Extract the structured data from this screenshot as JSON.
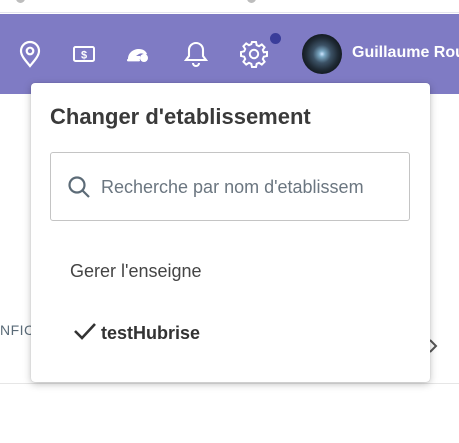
{
  "header": {
    "icons": [
      {
        "name": "location-pin-icon"
      },
      {
        "name": "cash-icon"
      },
      {
        "name": "delivery-icon"
      },
      {
        "name": "bell-icon"
      },
      {
        "name": "gear-icon"
      }
    ],
    "user_name": "Guillaume Rou",
    "colors": {
      "bar": "#7f7bc4",
      "notification": "#3a3d9a"
    }
  },
  "background": {
    "left_text": "NFIC"
  },
  "dropdown": {
    "title": "Changer d'etablissement",
    "search": {
      "placeholder": "Recherche par nom d'etablissem",
      "value": ""
    },
    "items": [
      {
        "label": "Gerer l'enseigne"
      },
      {
        "label": "testHubrise",
        "selected": true
      }
    ]
  }
}
